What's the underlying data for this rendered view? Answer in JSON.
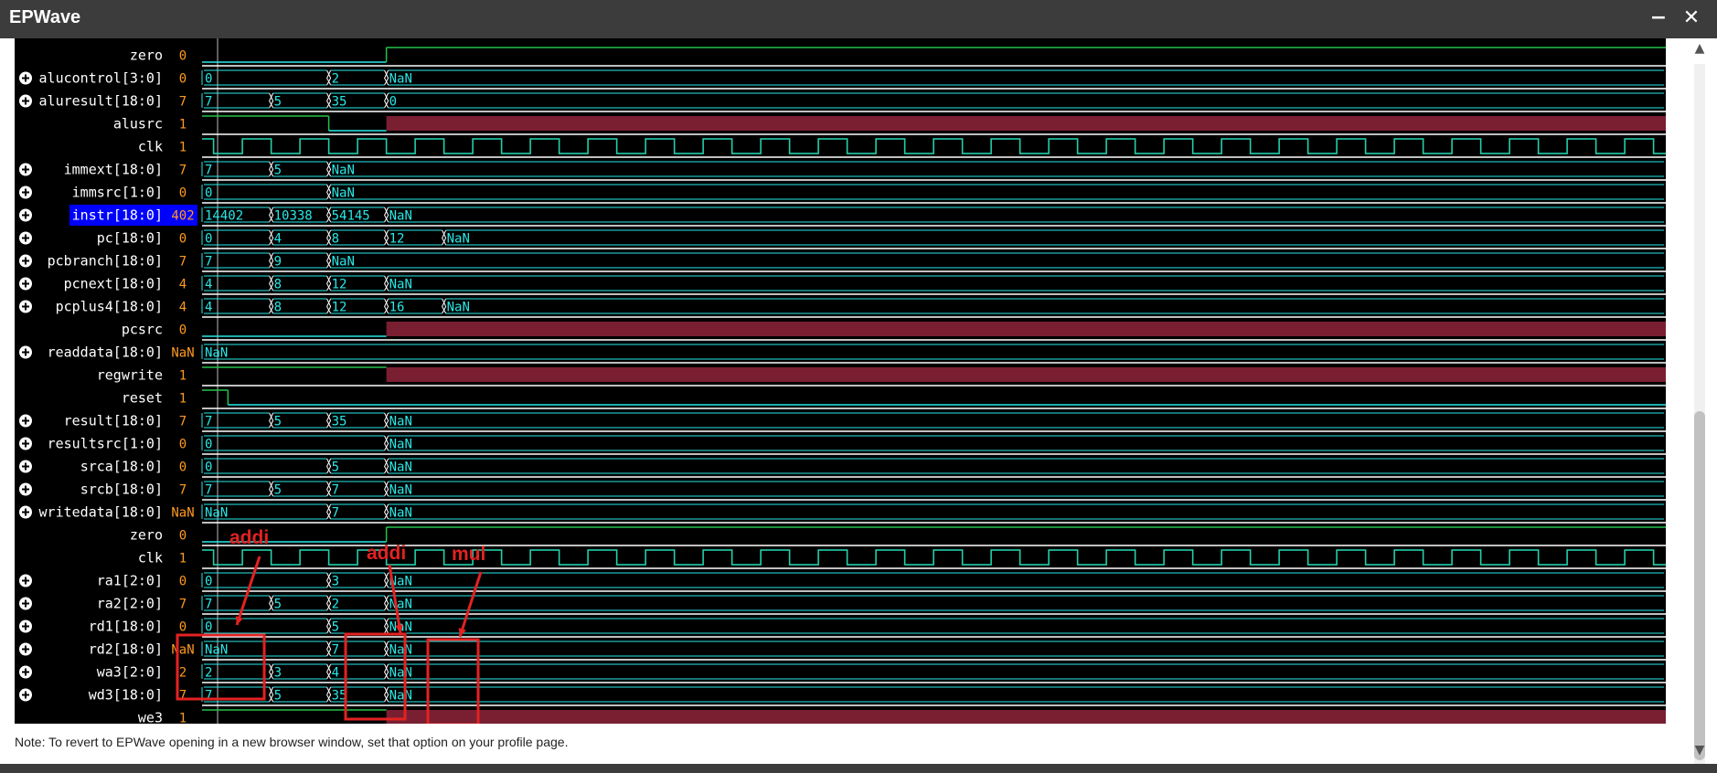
{
  "window": {
    "title": "EPWave",
    "minimize_label": "−",
    "close_label": "✕"
  },
  "cursor_signal": "instr[18:0]",
  "signals": [
    {
      "name": "zero",
      "value": "0",
      "type": "bit",
      "expandable": false,
      "wave": [
        {
          "t": 0,
          "v": 0
        },
        {
          "t": 3.2,
          "v": 1
        }
      ]
    },
    {
      "name": "alucontrol[3:0]",
      "value": "0",
      "type": "bus",
      "expandable": true,
      "wave": [
        {
          "t": 0,
          "l": "0"
        },
        {
          "t": 2.2,
          "l": "2"
        },
        {
          "t": 3.2,
          "l": "NaN"
        }
      ]
    },
    {
      "name": "aluresult[18:0]",
      "value": "7",
      "type": "bus",
      "expandable": true,
      "wave": [
        {
          "t": 0,
          "l": "7"
        },
        {
          "t": 1.2,
          "l": "5"
        },
        {
          "t": 2.2,
          "l": "35"
        },
        {
          "t": 3.2,
          "l": "0"
        }
      ]
    },
    {
      "name": "alusrc",
      "value": "1",
      "type": "bit",
      "expandable": false,
      "wave": [
        {
          "t": 0,
          "v": 1
        },
        {
          "t": 2.2,
          "v": 0
        },
        {
          "t": 3.2,
          "v": "x"
        }
      ]
    },
    {
      "name": "clk",
      "value": "1",
      "type": "clk",
      "expandable": false
    },
    {
      "name": "immext[18:0]",
      "value": "7",
      "type": "bus",
      "expandable": true,
      "wave": [
        {
          "t": 0,
          "l": "7"
        },
        {
          "t": 1.2,
          "l": "5"
        },
        {
          "t": 2.2,
          "l": "NaN"
        }
      ]
    },
    {
      "name": "immsrc[1:0]",
      "value": "0",
      "type": "bus",
      "expandable": true,
      "wave": [
        {
          "t": 0,
          "l": "0"
        },
        {
          "t": 2.2,
          "l": "NaN"
        }
      ]
    },
    {
      "name": "instr[18:0]",
      "value": "402",
      "type": "bus",
      "expandable": true,
      "wave": [
        {
          "t": 0,
          "l": "14402"
        },
        {
          "t": 1.2,
          "l": "10338"
        },
        {
          "t": 2.2,
          "l": "54145"
        },
        {
          "t": 3.2,
          "l": "NaN"
        }
      ]
    },
    {
      "name": "pc[18:0]",
      "value": "0",
      "type": "bus",
      "expandable": true,
      "wave": [
        {
          "t": 0,
          "l": "0"
        },
        {
          "t": 1.2,
          "l": "4"
        },
        {
          "t": 2.2,
          "l": "8"
        },
        {
          "t": 3.2,
          "l": "12"
        },
        {
          "t": 4.2,
          "l": "NaN"
        }
      ]
    },
    {
      "name": "pcbranch[18:0]",
      "value": "7",
      "type": "bus",
      "expandable": true,
      "wave": [
        {
          "t": 0,
          "l": "7"
        },
        {
          "t": 1.2,
          "l": "9"
        },
        {
          "t": 2.2,
          "l": "NaN"
        }
      ]
    },
    {
      "name": "pcnext[18:0]",
      "value": "4",
      "type": "bus",
      "expandable": true,
      "wave": [
        {
          "t": 0,
          "l": "4"
        },
        {
          "t": 1.2,
          "l": "8"
        },
        {
          "t": 2.2,
          "l": "12"
        },
        {
          "t": 3.2,
          "l": "NaN"
        }
      ]
    },
    {
      "name": "pcplus4[18:0]",
      "value": "4",
      "type": "bus",
      "expandable": true,
      "wave": [
        {
          "t": 0,
          "l": "4"
        },
        {
          "t": 1.2,
          "l": "8"
        },
        {
          "t": 2.2,
          "l": "12"
        },
        {
          "t": 3.2,
          "l": "16"
        },
        {
          "t": 4.2,
          "l": "NaN"
        }
      ]
    },
    {
      "name": "pcsrc",
      "value": "0",
      "type": "bit",
      "expandable": false,
      "wave": [
        {
          "t": 0,
          "v": 0
        },
        {
          "t": 3.2,
          "v": "x"
        }
      ]
    },
    {
      "name": "readdata[18:0]",
      "value": "NaN",
      "type": "bus",
      "expandable": true,
      "wave": [
        {
          "t": 0,
          "l": "NaN"
        }
      ]
    },
    {
      "name": "regwrite",
      "value": "1",
      "type": "bit",
      "expandable": false,
      "wave": [
        {
          "t": 0,
          "v": 1
        },
        {
          "t": 3.2,
          "v": "x"
        }
      ]
    },
    {
      "name": "reset",
      "value": "1",
      "type": "bit",
      "expandable": false,
      "wave": [
        {
          "t": 0,
          "v": 1
        },
        {
          "t": 0.45,
          "v": 0
        }
      ]
    },
    {
      "name": "result[18:0]",
      "value": "7",
      "type": "bus",
      "expandable": true,
      "wave": [
        {
          "t": 0,
          "l": "7"
        },
        {
          "t": 1.2,
          "l": "5"
        },
        {
          "t": 2.2,
          "l": "35"
        },
        {
          "t": 3.2,
          "l": "NaN"
        }
      ]
    },
    {
      "name": "resultsrc[1:0]",
      "value": "0",
      "type": "bus",
      "expandable": true,
      "wave": [
        {
          "t": 0,
          "l": "0"
        },
        {
          "t": 3.2,
          "l": "NaN"
        }
      ]
    },
    {
      "name": "srca[18:0]",
      "value": "0",
      "type": "bus",
      "expandable": true,
      "wave": [
        {
          "t": 0,
          "l": "0"
        },
        {
          "t": 2.2,
          "l": "5"
        },
        {
          "t": 3.2,
          "l": "NaN"
        }
      ]
    },
    {
      "name": "srcb[18:0]",
      "value": "7",
      "type": "bus",
      "expandable": true,
      "wave": [
        {
          "t": 0,
          "l": "7"
        },
        {
          "t": 1.2,
          "l": "5"
        },
        {
          "t": 2.2,
          "l": "7"
        },
        {
          "t": 3.2,
          "l": "NaN"
        }
      ]
    },
    {
      "name": "writedata[18:0]",
      "value": "NaN",
      "type": "bus",
      "expandable": true,
      "wave": [
        {
          "t": 0,
          "l": "NaN"
        },
        {
          "t": 2.2,
          "l": "7"
        },
        {
          "t": 3.2,
          "l": "NaN"
        }
      ]
    },
    {
      "name": "zero",
      "value": "0",
      "type": "bit",
      "expandable": false,
      "wave": [
        {
          "t": 0,
          "v": 0
        },
        {
          "t": 3.2,
          "v": 1
        }
      ]
    },
    {
      "name": "clk",
      "value": "1",
      "type": "clk",
      "expandable": false
    },
    {
      "name": "ra1[2:0]",
      "value": "0",
      "type": "bus",
      "expandable": true,
      "wave": [
        {
          "t": 0,
          "l": "0"
        },
        {
          "t": 2.2,
          "l": "3"
        },
        {
          "t": 3.2,
          "l": "NaN"
        }
      ]
    },
    {
      "name": "ra2[2:0]",
      "value": "7",
      "type": "bus",
      "expandable": true,
      "wave": [
        {
          "t": 0,
          "l": "7"
        },
        {
          "t": 1.2,
          "l": "5"
        },
        {
          "t": 2.2,
          "l": "2"
        },
        {
          "t": 3.2,
          "l": "NaN"
        }
      ]
    },
    {
      "name": "rd1[18:0]",
      "value": "0",
      "type": "bus",
      "expandable": true,
      "wave": [
        {
          "t": 0,
          "l": "0"
        },
        {
          "t": 2.2,
          "l": "5"
        },
        {
          "t": 3.2,
          "l": "NaN"
        }
      ]
    },
    {
      "name": "rd2[18:0]",
      "value": "NaN",
      "type": "bus",
      "expandable": true,
      "wave": [
        {
          "t": 0,
          "l": "NaN"
        },
        {
          "t": 2.2,
          "l": "7"
        },
        {
          "t": 3.2,
          "l": "NaN"
        }
      ]
    },
    {
      "name": "wa3[2:0]",
      "value": "2",
      "type": "bus",
      "expandable": true,
      "wave": [
        {
          "t": 0,
          "l": "2"
        },
        {
          "t": 1.2,
          "l": "3"
        },
        {
          "t": 2.2,
          "l": "4"
        },
        {
          "t": 3.2,
          "l": "NaN"
        }
      ]
    },
    {
      "name": "wd3[18:0]",
      "value": "7",
      "type": "bus",
      "expandable": true,
      "wave": [
        {
          "t": 0,
          "l": "7"
        },
        {
          "t": 1.2,
          "l": "5"
        },
        {
          "t": 2.2,
          "l": "35"
        },
        {
          "t": 3.2,
          "l": "NaN"
        }
      ]
    },
    {
      "name": "we3",
      "value": "1",
      "type": "bit",
      "expandable": false,
      "wave": [
        {
          "t": 0,
          "v": 1
        },
        {
          "t": 3.2,
          "v": "x"
        }
      ]
    }
  ],
  "annotations": [
    {
      "label": "addi",
      "color": "#e32222"
    },
    {
      "label": "addi",
      "color": "#e32222"
    },
    {
      "label": "mul",
      "color": "#e32222"
    }
  ],
  "colors": {
    "wave": "#28e8e8",
    "bit_wave": "#22c24a",
    "value": "#ff9a1f",
    "undefined": "#7a1f32",
    "cursor_bg": "#0000ff",
    "annotation": "#e32222"
  },
  "footer_note": "Note: To revert to EPWave opening in a new browser window, set that option on your profile page."
}
